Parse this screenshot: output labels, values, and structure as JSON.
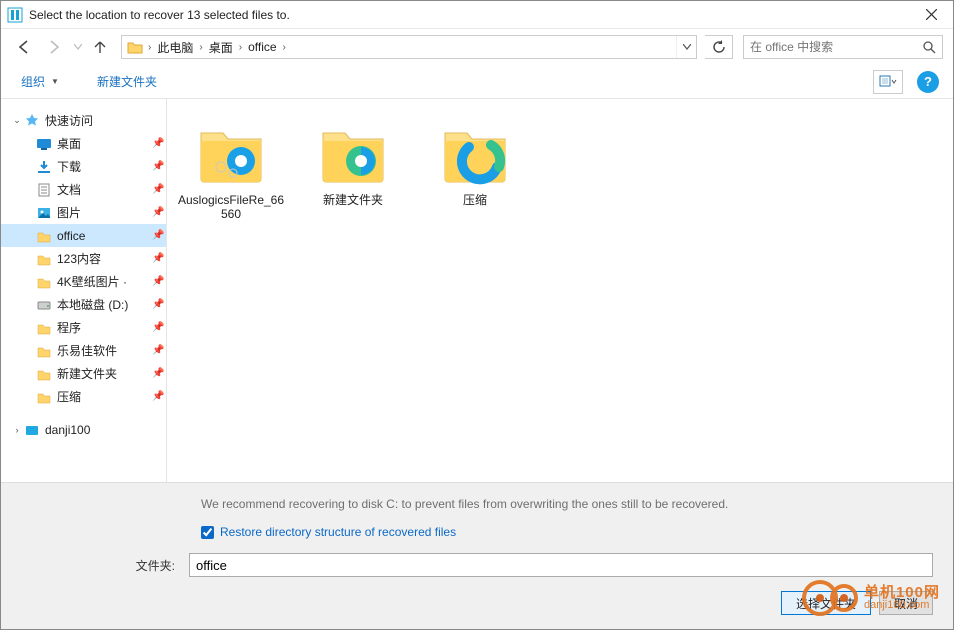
{
  "window": {
    "title": "Select the location to recover 13 selected files to."
  },
  "breadcrumb": {
    "segments": [
      "此电脑",
      "桌面",
      "office"
    ]
  },
  "search": {
    "placeholder": "在 office 中搜索"
  },
  "toolbar": {
    "organize": "组织",
    "newfolder": "新建文件夹"
  },
  "sidebar": {
    "quick": "快速访问",
    "items": [
      {
        "label": "桌面",
        "icon": "desktop"
      },
      {
        "label": "下载",
        "icon": "download"
      },
      {
        "label": "文档",
        "icon": "document"
      },
      {
        "label": "图片",
        "icon": "picture"
      },
      {
        "label": "office",
        "icon": "folder",
        "selected": true
      },
      {
        "label": "123内容",
        "icon": "folder"
      },
      {
        "label": "4K壁纸图片 ·",
        "icon": "folder"
      },
      {
        "label": "本地磁盘 (D:)",
        "icon": "drive"
      },
      {
        "label": "程序",
        "icon": "folder"
      },
      {
        "label": "乐易佳软件",
        "icon": "folder"
      },
      {
        "label": "新建文件夹",
        "icon": "folder"
      },
      {
        "label": "压缩",
        "icon": "folder"
      }
    ],
    "after": {
      "label": "danji100",
      "icon": "bluefolder"
    }
  },
  "files": [
    {
      "name": "AuslogicsFileRe_66560",
      "kind": "gear"
    },
    {
      "name": "新建文件夹",
      "kind": "edge"
    },
    {
      "name": "压缩",
      "kind": "edge2"
    }
  ],
  "footer": {
    "recommend": "We recommend recovering to disk C: to prevent files from overwriting the ones still to be recovered.",
    "restore_label": "Restore directory structure of recovered files",
    "folder_label": "文件夹:",
    "folder_value": "office",
    "select_btn": "选择文件夹",
    "cancel_btn": "取消"
  },
  "watermark": {
    "line1": "单机100网",
    "line2": "danji100.com"
  }
}
